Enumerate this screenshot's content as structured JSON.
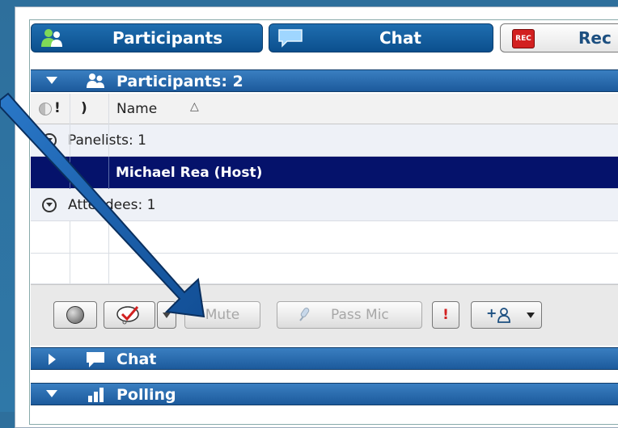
{
  "tabs": [
    {
      "label": "Participants"
    },
    {
      "label": "Chat"
    },
    {
      "label": "Rec",
      "icon_text": "REC"
    }
  ],
  "participants_section": {
    "title": "Participants: 2"
  },
  "columns": {
    "exclaim": "!",
    "paren": ")",
    "name": "Name",
    "sort_glyph": "△"
  },
  "groups": {
    "panelists": "Panelists: 1",
    "host_name": "Michael Rea (Host)",
    "attendees": "Attendees: 1"
  },
  "toolbar": {
    "mute_label": "Mute",
    "pass_mic_label": "Pass Mic",
    "alert_label": "!",
    "add_glyph": "+"
  },
  "chat_section": {
    "title": "Chat"
  },
  "polling_section": {
    "title": "Polling"
  },
  "colors": {
    "background": "#2e6f9c",
    "tab_blue": "#0b4f8e",
    "selected_row": "#05126b",
    "arrow": "#1f5fae",
    "rec_red": "#d22020"
  },
  "icons": [
    "participants-icon",
    "chat-bubble-icon",
    "rec-icon",
    "record-button-icon",
    "checkmark-icon",
    "add-person-icon",
    "microphone-icon"
  ]
}
